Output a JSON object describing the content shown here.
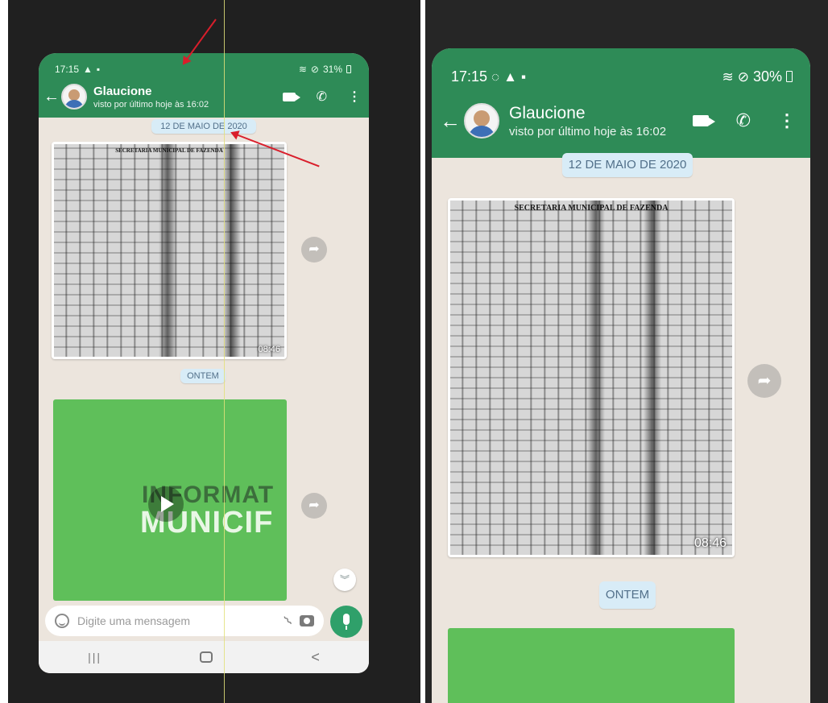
{
  "left": {
    "status": {
      "time": "17:15",
      "battery": "31%"
    },
    "chat": {
      "contact_name": "Glaucione",
      "last_seen": "visto por último hoje às 16:02",
      "date_chip": "12 DE MAIO DE 2020",
      "doc_header": "SECRETARIA MUNICIPAL DE FAZENDA",
      "photo_time": "08:46",
      "ontem_chip": "ONTEM",
      "video_text_line1": "INFORMAT",
      "video_text_line2": "MUNICIF"
    },
    "input": {
      "placeholder": "Digite uma mensagem"
    },
    "nav": {
      "recents": "|||",
      "back": "<"
    }
  },
  "right": {
    "status": {
      "time": "17:15",
      "battery": "30%"
    },
    "chat": {
      "contact_name": "Glaucione",
      "last_seen": "visto por último hoje às 16:02",
      "date_chip": "12 DE MAIO DE 2020",
      "doc_header": "SECRETARIA MUNICIPAL DE FAZENDA",
      "photo_time": "08:46",
      "ontem_chip": "ONTEM"
    }
  },
  "icons": {
    "warning": "warning-icon",
    "sim": "sim-card-icon",
    "whatsapp": "whatsapp-icon",
    "wifi": "wifi-icon",
    "dnd": "do-not-disturb-icon",
    "battery": "battery-icon",
    "back": "arrow-left-icon",
    "video": "video-call-icon",
    "phone": "phone-icon",
    "menu": "more-vert-icon",
    "share": "forward-icon",
    "play": "play-icon",
    "chevron": "chevron-double-down-icon",
    "emoji": "emoji-icon",
    "attach": "paperclip-icon",
    "camera": "camera-icon",
    "mic": "mic-icon"
  },
  "colors": {
    "header_green": "#2e8b57",
    "chat_bg": "#ece5dd",
    "chip_bg": "#d8ecf7",
    "mic_green": "#2fa06a",
    "annotation_red": "#d91e2b",
    "guide_yellow": "#e3e07a"
  }
}
